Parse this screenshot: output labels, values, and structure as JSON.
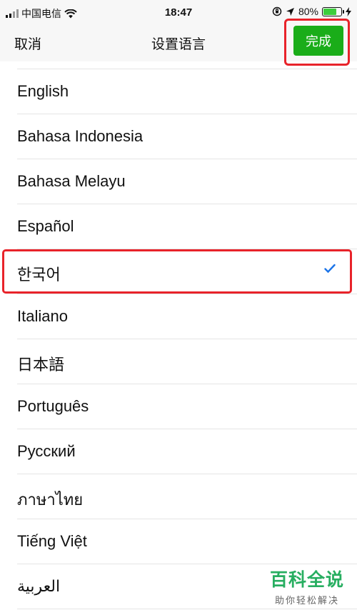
{
  "status_bar": {
    "carrier": "中国电信",
    "time": "18:47",
    "battery": "80%",
    "battery_level": 0.8,
    "icons": [
      "signal-icon",
      "wifi-icon",
      "orientation-lock-icon",
      "location-icon",
      "battery-icon",
      "charging-icon"
    ]
  },
  "nav": {
    "cancel_label": "取消",
    "title": "设置语言",
    "done_label": "完成"
  },
  "languages": [
    {
      "label": "English"
    },
    {
      "label": "Bahasa Indonesia"
    },
    {
      "label": "Bahasa Melayu"
    },
    {
      "label": "Español"
    },
    {
      "label": "한국어",
      "selected": true
    },
    {
      "label": "Italiano"
    },
    {
      "label": "日本語"
    },
    {
      "label": "Português"
    },
    {
      "label": "Русский"
    },
    {
      "label": "ภาษาไทย"
    },
    {
      "label": "Tiếng Việt"
    },
    {
      "label": "العربية"
    }
  ],
  "watermark": {
    "title": "百科全说",
    "subtitle": "助你轻松解决"
  },
  "colors": {
    "accent": "#1aad19",
    "highlight": "#e8232a",
    "check": "#1a73e8"
  }
}
